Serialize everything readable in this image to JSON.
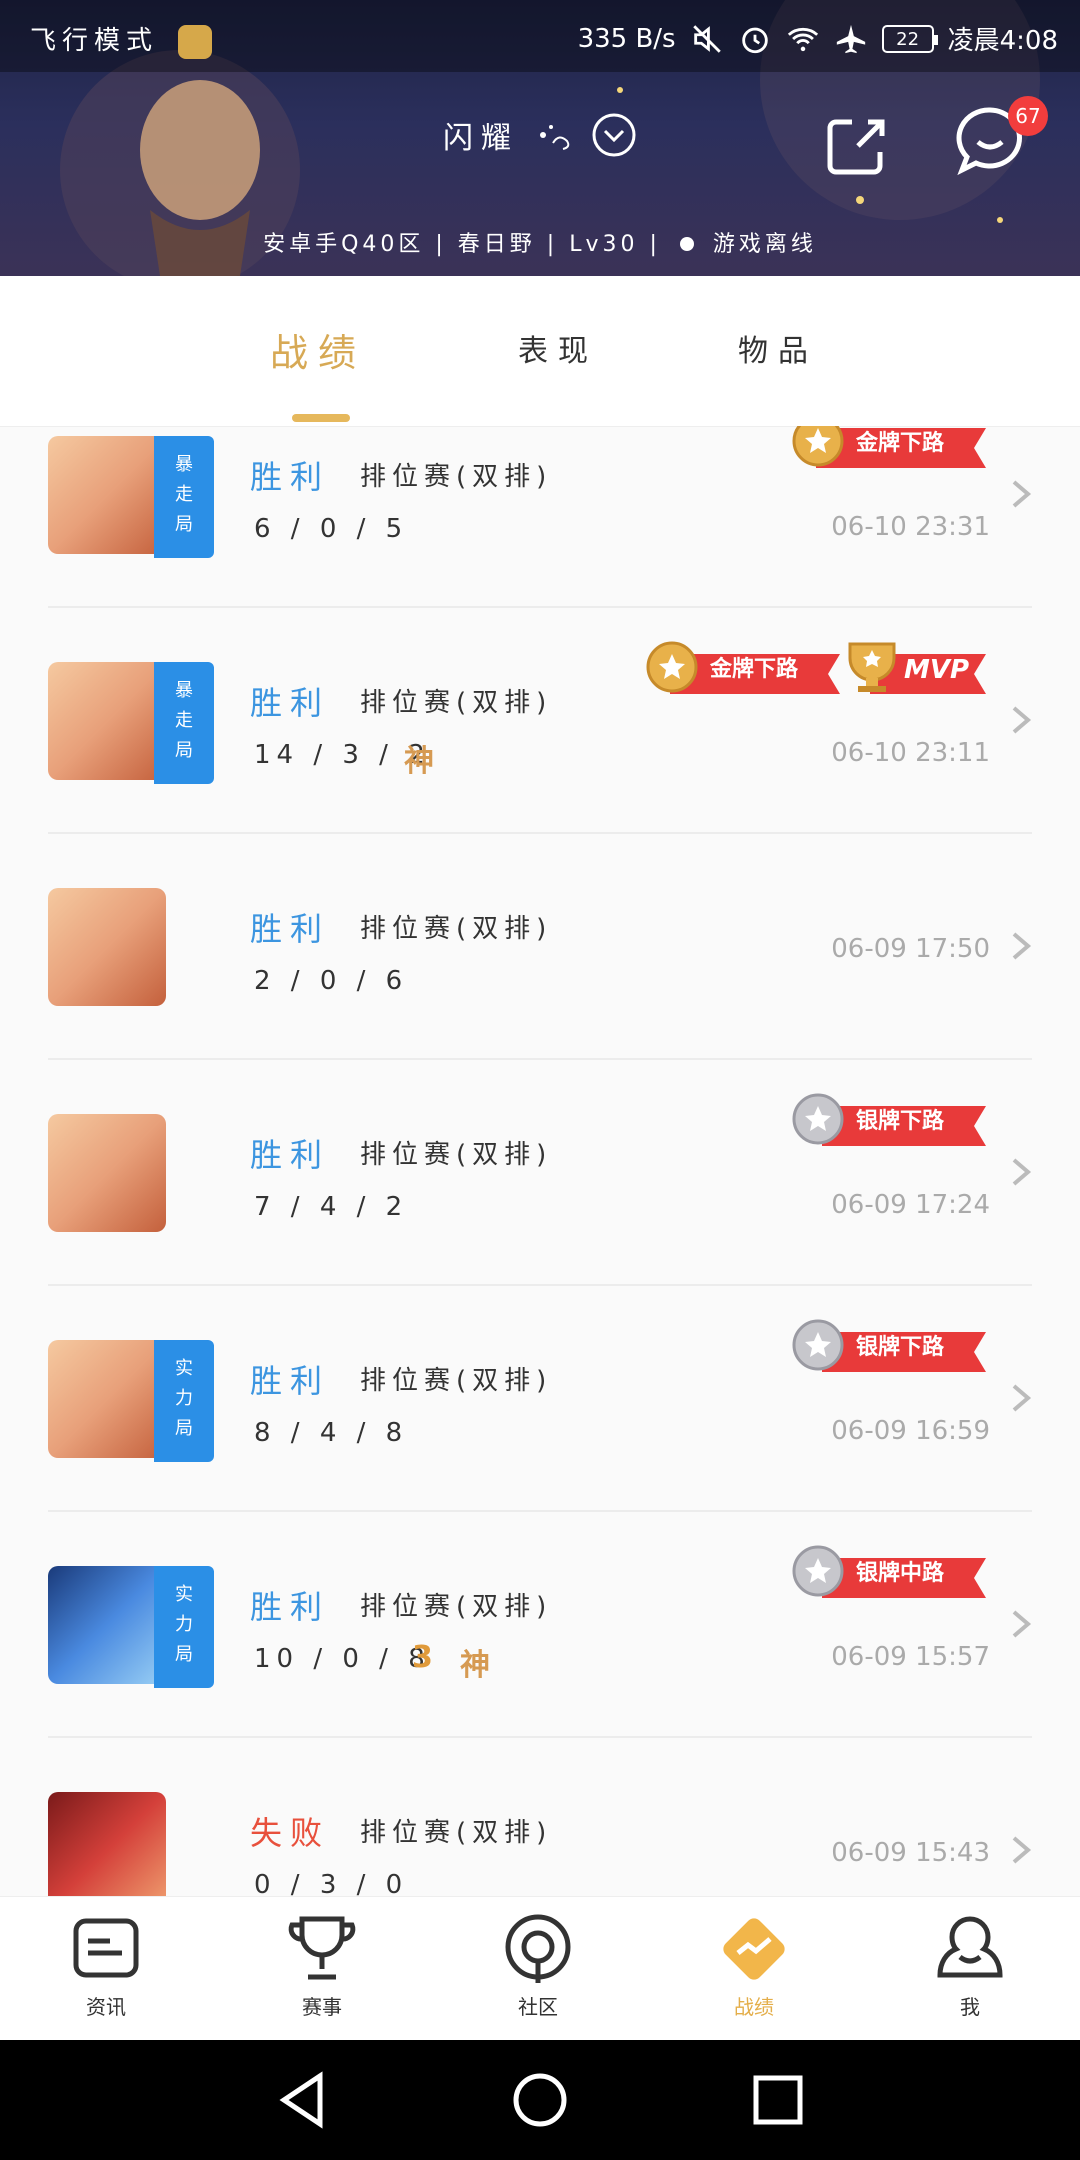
{
  "status_bar": {
    "left_text": "飞行模式",
    "speed": "335 B/s",
    "battery": "22",
    "time": "凌晨4:08"
  },
  "header": {
    "player_name": "闪耀",
    "server_info": "安卓手Q40区 | 春日野 | Lv30 |",
    "online_status": "游戏离线",
    "message_count": "67"
  },
  "tabs": [
    {
      "label": "战绩",
      "active": true
    },
    {
      "label": "表现",
      "active": false
    },
    {
      "label": "物品",
      "active": false
    }
  ],
  "matches": [
    {
      "result": "胜利",
      "mode": "排位赛(双排)",
      "kda": "6 / 0 / 5",
      "time": "06-10 23:31",
      "mode_tag": "暴走局",
      "awards": [
        "金牌下路"
      ],
      "god": "",
      "multi": ""
    },
    {
      "result": "胜利",
      "mode": "排位赛(双排)",
      "kda": "14 / 3 / 2",
      "time": "06-10 23:11",
      "mode_tag": "暴走局",
      "awards": [
        "金牌下路",
        "MVP"
      ],
      "god": "神",
      "multi": ""
    },
    {
      "result": "胜利",
      "mode": "排位赛(双排)",
      "kda": "2 / 0 / 6",
      "time": "06-09 17:50",
      "mode_tag": "",
      "awards": [],
      "god": "",
      "multi": ""
    },
    {
      "result": "胜利",
      "mode": "排位赛(双排)",
      "kda": "7 / 4 / 2",
      "time": "06-09 17:24",
      "mode_tag": "",
      "awards": [
        "银牌下路"
      ],
      "god": "",
      "multi": ""
    },
    {
      "result": "胜利",
      "mode": "排位赛(双排)",
      "kda": "8 / 4 / 8",
      "time": "06-09 16:59",
      "mode_tag": "实力局",
      "awards": [
        "银牌下路"
      ],
      "god": "",
      "multi": ""
    },
    {
      "result": "胜利",
      "mode": "排位赛(双排)",
      "kda": "10 / 0 / 8",
      "time": "06-09 15:57",
      "mode_tag": "实力局",
      "awards": [
        "银牌中路"
      ],
      "god": "神",
      "multi": "3"
    },
    {
      "result": "失败",
      "mode": "排位赛(双排)",
      "kda": "0 / 3 / 0",
      "time": "06-09 15:43",
      "mode_tag": "",
      "awards": [],
      "god": "",
      "multi": ""
    }
  ],
  "bottom_nav": [
    {
      "label": "资讯",
      "icon": "news-icon",
      "active": false
    },
    {
      "label": "赛事",
      "icon": "trophy-icon",
      "active": false
    },
    {
      "label": "社区",
      "icon": "community-icon",
      "active": false
    },
    {
      "label": "战绩",
      "icon": "record-icon",
      "active": true
    },
    {
      "label": "我",
      "icon": "profile-icon",
      "active": false
    }
  ],
  "colors": {
    "accent": "#d7a955",
    "win": "#3c95e0",
    "lose": "#e8503c",
    "tag_blue": "#2b8fe6",
    "award_red": "#e83a3a"
  }
}
